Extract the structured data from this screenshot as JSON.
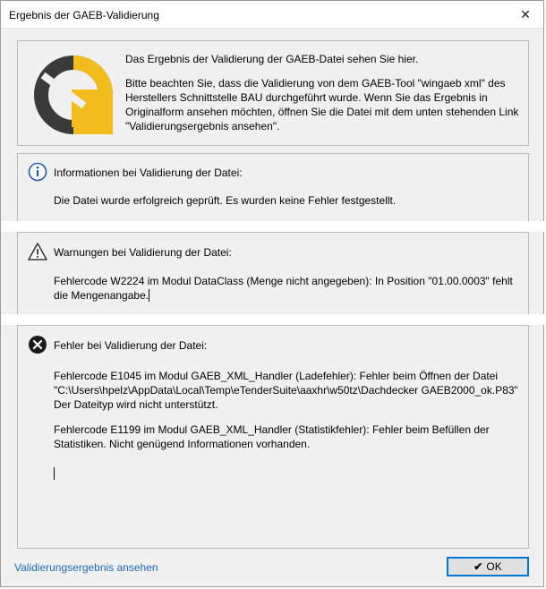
{
  "window": {
    "title": "Ergebnis der GAEB-Validierung",
    "close": "✕"
  },
  "intro": {
    "line1": "Das Ergebnis der Validierung der GAEB-Datei sehen Sie hier.",
    "line2": "Bitte beachten Sie, dass die Validierung von dem GAEB-Tool \"wingaeb xml\" des Herstellers Schnittstelle BAU durchgeführt wurde. Wenn Sie das Ergebnis in Originalform ansehen möchten, öffnen Sie die Datei mit dem unten stehenden Link \"Validierungsergebnis ansehen\"."
  },
  "info": {
    "icon": "info-icon",
    "header": "Informationen bei Validierung der Datei:",
    "message": "Die Datei wurde erfolgreich geprüft. Es wurden keine Fehler festgestellt."
  },
  "warnings": {
    "icon": "warning-icon",
    "header": "Warnungen bei Validierung der Datei:",
    "message": "Fehlercode W2224 im Modul DataClass (Menge nicht angegeben): In Position  \"01.00.0003\" fehlt die Mengenangabe."
  },
  "errors": {
    "icon": "error-icon",
    "header": "Fehler bei Validierung der Datei:",
    "message1": "Fehlercode E1045 im Modul GAEB_XML_Handler (Ladefehler): Fehler beim Öffnen der Datei \"C:\\Users\\hpelz\\AppData\\Local\\Temp\\eTenderSuite\\aaxhr\\w50tz\\Dachdecker GAEB2000_ok.P83\" Der Dateityp wird nicht unterstützt.",
    "message2": "Fehlercode E1199 im Modul GAEB_XML_Handler (Statistikfehler): Fehler beim Befüllen der Statistiken. Nicht genügend Informationen vorhanden."
  },
  "footer": {
    "link": "Validierungsergebnis ansehen",
    "ok": "OK"
  },
  "colors": {
    "logo_yellow": "#f2bd1c",
    "logo_dark": "#3a3a3a",
    "link": "#1e6ab8",
    "focus": "#0078d7"
  }
}
